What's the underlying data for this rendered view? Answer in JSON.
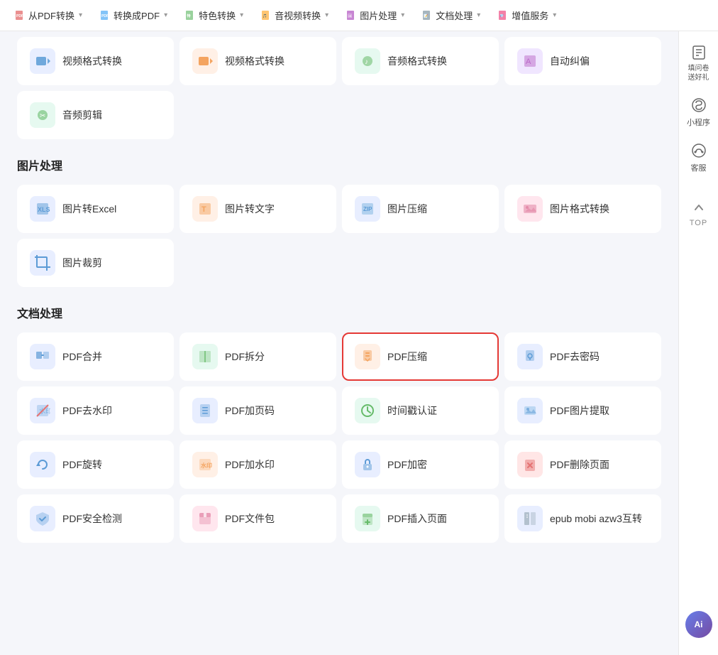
{
  "nav": {
    "items": [
      {
        "id": "from-pdf",
        "label": "从PDF转换",
        "icon": "📄"
      },
      {
        "id": "to-pdf",
        "label": "转换成PDF",
        "icon": "📋"
      },
      {
        "id": "special",
        "label": "特色转换",
        "icon": "⭐"
      },
      {
        "id": "av",
        "label": "音视频转换",
        "icon": "🎵"
      },
      {
        "id": "image",
        "label": "图片处理",
        "icon": "🖼️"
      },
      {
        "id": "doc",
        "label": "文档处理",
        "icon": "📝"
      },
      {
        "id": "vip",
        "label": "增值服务",
        "icon": "💎"
      }
    ]
  },
  "sections": [
    {
      "id": "audio-top",
      "tools": [
        {
          "id": "video-format1",
          "name": "视频格式转换",
          "iconBg": "icon-blue-light",
          "iconChar": "🎬",
          "highlighted": false
        },
        {
          "id": "video-format2",
          "name": "视频格式转换",
          "iconBg": "icon-orange-light",
          "iconChar": "🎥",
          "highlighted": false
        },
        {
          "id": "audio-format",
          "name": "音频格式转换",
          "iconBg": "icon-green-light",
          "iconChar": "🎵",
          "highlighted": false
        },
        {
          "id": "auto-correct",
          "name": "自动纠偏",
          "iconBg": "icon-purple-light",
          "iconChar": "✏️",
          "highlighted": false
        }
      ]
    },
    {
      "id": "audio-edit-row",
      "tools": [
        {
          "id": "audio-trim",
          "name": "音频剪辑",
          "iconBg": "icon-green-light",
          "iconChar": "✂️",
          "highlighted": false
        }
      ]
    }
  ],
  "image_section": {
    "header": "图片处理",
    "tools": [
      {
        "id": "img-excel",
        "name": "图片转Excel",
        "iconBg": "icon-blue-light",
        "iconChar": "📊",
        "highlighted": false
      },
      {
        "id": "img-text",
        "name": "图片转文字",
        "iconBg": "icon-orange-light",
        "iconChar": "📝",
        "highlighted": false
      },
      {
        "id": "img-compress",
        "name": "图片压缩",
        "iconBg": "icon-blue-light",
        "iconChar": "🗜️",
        "highlighted": false
      },
      {
        "id": "img-format",
        "name": "图片格式转换",
        "iconBg": "icon-pink-light",
        "iconChar": "🖼️",
        "highlighted": false
      },
      {
        "id": "img-crop",
        "name": "图片裁剪",
        "iconBg": "icon-blue-light",
        "iconChar": "✂️",
        "highlighted": false
      }
    ]
  },
  "doc_section": {
    "header": "文档处理",
    "tools": [
      {
        "id": "pdf-merge",
        "name": "PDF合并",
        "iconBg": "icon-blue-light",
        "iconChar": "🔗",
        "highlighted": false
      },
      {
        "id": "pdf-split",
        "name": "PDF拆分",
        "iconBg": "icon-green-light",
        "iconChar": "✂️",
        "highlighted": false
      },
      {
        "id": "pdf-compress",
        "name": "PDF压缩",
        "iconBg": "icon-orange-light",
        "iconChar": "🗜️",
        "highlighted": true
      },
      {
        "id": "pdf-decrypt",
        "name": "PDF去密码",
        "iconBg": "icon-blue-light",
        "iconChar": "🔓",
        "highlighted": false
      },
      {
        "id": "pdf-watermark-remove",
        "name": "PDF去水印",
        "iconBg": "icon-blue-light",
        "iconChar": "💧",
        "highlighted": false
      },
      {
        "id": "pdf-page-num",
        "name": "PDF加页码",
        "iconBg": "icon-blue-light",
        "iconChar": "🔢",
        "highlighted": false
      },
      {
        "id": "timestamp",
        "name": "时间戳认证",
        "iconBg": "icon-green-light",
        "iconChar": "🕐",
        "highlighted": false
      },
      {
        "id": "pdf-img-extract",
        "name": "PDF图片提取",
        "iconBg": "icon-blue-light",
        "iconChar": "🖼️",
        "highlighted": false
      },
      {
        "id": "pdf-rotate",
        "name": "PDF旋转",
        "iconBg": "icon-blue-light",
        "iconChar": "🔄",
        "highlighted": false
      },
      {
        "id": "pdf-watermark-add",
        "name": "PDF加水印",
        "iconBg": "icon-orange-light",
        "iconChar": "💧",
        "highlighted": false
      },
      {
        "id": "pdf-encrypt",
        "name": "PDF加密",
        "iconBg": "icon-blue-light",
        "iconChar": "🔒",
        "highlighted": false
      },
      {
        "id": "pdf-delete-page",
        "name": "PDF删除页面",
        "iconBg": "icon-red-light",
        "iconChar": "🗑️",
        "highlighted": false
      },
      {
        "id": "pdf-security",
        "name": "PDF安全检测",
        "iconBg": "icon-blue-light",
        "iconChar": "🛡️",
        "highlighted": false
      },
      {
        "id": "pdf-package",
        "name": "PDF文件包",
        "iconBg": "icon-pink-light",
        "iconChar": "📦",
        "highlighted": false
      },
      {
        "id": "pdf-insert-page",
        "name": "PDF插入页面",
        "iconBg": "icon-green-light",
        "iconChar": "➕",
        "highlighted": false
      },
      {
        "id": "epub-mobi",
        "name": "epub mobi azw3互转",
        "iconBg": "icon-blue-light",
        "iconChar": "📚",
        "highlighted": false
      }
    ]
  },
  "sidebar": {
    "survey": "填问卷\n送好礼",
    "miniapp": "小程序",
    "service": "客服",
    "top": "TOP",
    "ai_label": "Ai"
  }
}
